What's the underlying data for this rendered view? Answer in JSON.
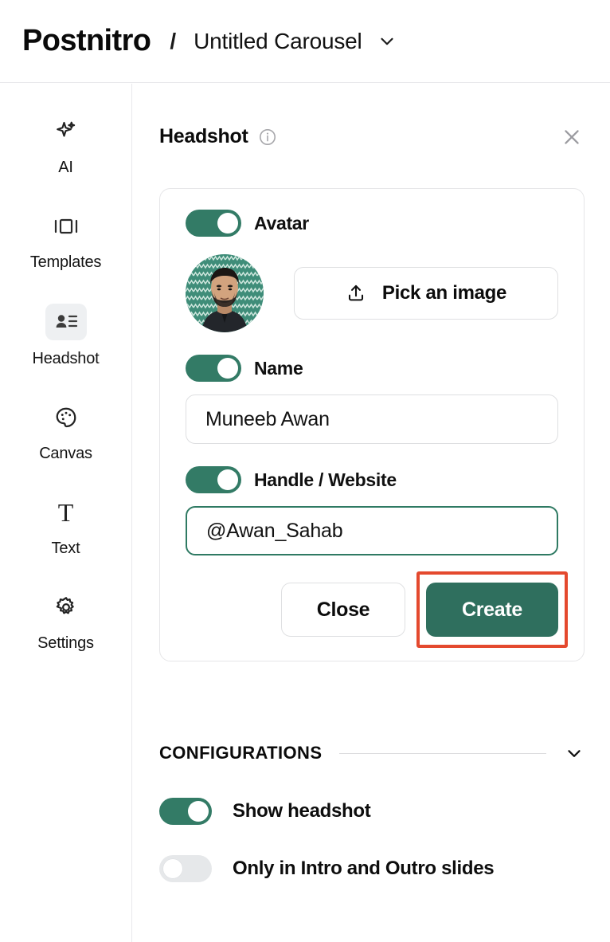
{
  "colors": {
    "accent_green": "#337b66",
    "create_green": "#2f6f5e",
    "annotation_red": "#e4492e",
    "toggle_off": "#e6e8ea",
    "border": "#e6e6e8"
  },
  "topbar": {
    "brand": "Postnitro",
    "separator": "/",
    "doc_title": "Untitled Carousel",
    "caret_icon": "chevron-down-icon"
  },
  "sidebar": {
    "items": [
      {
        "label": "AI",
        "icon": "sparkle-icon",
        "active": false
      },
      {
        "label": "Templates",
        "icon": "carousel-icon",
        "active": false
      },
      {
        "label": "Headshot",
        "icon": "contact-card-icon",
        "active": true
      },
      {
        "label": "Canvas",
        "icon": "palette-icon",
        "active": false
      },
      {
        "label": "Text",
        "icon": "text-t-icon",
        "active": false
      },
      {
        "label": "Settings",
        "icon": "gear-icon",
        "active": false
      }
    ]
  },
  "panel": {
    "title": "Headshot",
    "info_icon": "info-circle-icon",
    "close_icon": "close-icon"
  },
  "card": {
    "avatar": {
      "toggle_label": "Avatar",
      "toggle_on": true,
      "image_alt": "user-avatar-photo",
      "pick_button_label": "Pick an image",
      "pick_button_icon": "upload-icon"
    },
    "name": {
      "toggle_label": "Name",
      "toggle_on": true,
      "value": "Muneeb Awan",
      "placeholder": "Enter your name"
    },
    "handle": {
      "toggle_label": "Handle / Website",
      "toggle_on": true,
      "value": "@Awan_Sahab",
      "placeholder": "Enter your handle",
      "focused": true
    },
    "buttons": {
      "close_label": "Close",
      "create_label": "Create",
      "create_highlighted": true
    }
  },
  "configurations": {
    "section_title": "CONFIGURATIONS",
    "collapse_icon": "chevron-down-icon",
    "rows": [
      {
        "label": "Show headshot",
        "toggle_on": true
      },
      {
        "label": "Only in Intro and Outro slides",
        "toggle_on": false
      }
    ]
  }
}
